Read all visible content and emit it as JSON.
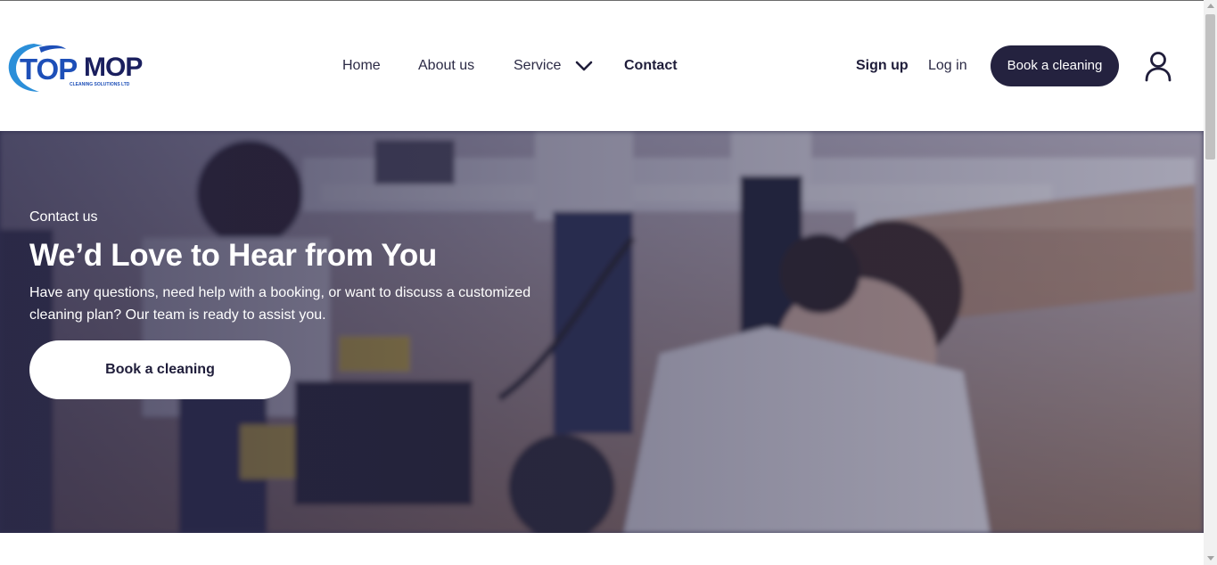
{
  "brand": {
    "name_part1": "TOP",
    "name_part2": "MOP",
    "tagline": "CLEANING SOLUTIONS LTD",
    "colors": {
      "blue": "#1d4fb8",
      "navy": "#1a1f5e",
      "swoosh": "#2b8fd9"
    }
  },
  "nav": {
    "home": "Home",
    "about": "About us",
    "service": "Service",
    "contact": "Contact",
    "service_icon": "chevron-down-icon"
  },
  "header_actions": {
    "signup": "Sign up",
    "login": "Log in",
    "book": "Book a cleaning",
    "account_icon": "user-icon"
  },
  "hero": {
    "eyebrow": "Contact us",
    "title": "We’d Love to Hear from You",
    "description": "Have any questions, need help with a booking, or want to discuss a customized cleaning plan? Our team is ready to assist you.",
    "cta": "Book a cleaning"
  },
  "colors": {
    "primary": "#24223f",
    "hero_overlay": "#262446",
    "white": "#ffffff"
  }
}
